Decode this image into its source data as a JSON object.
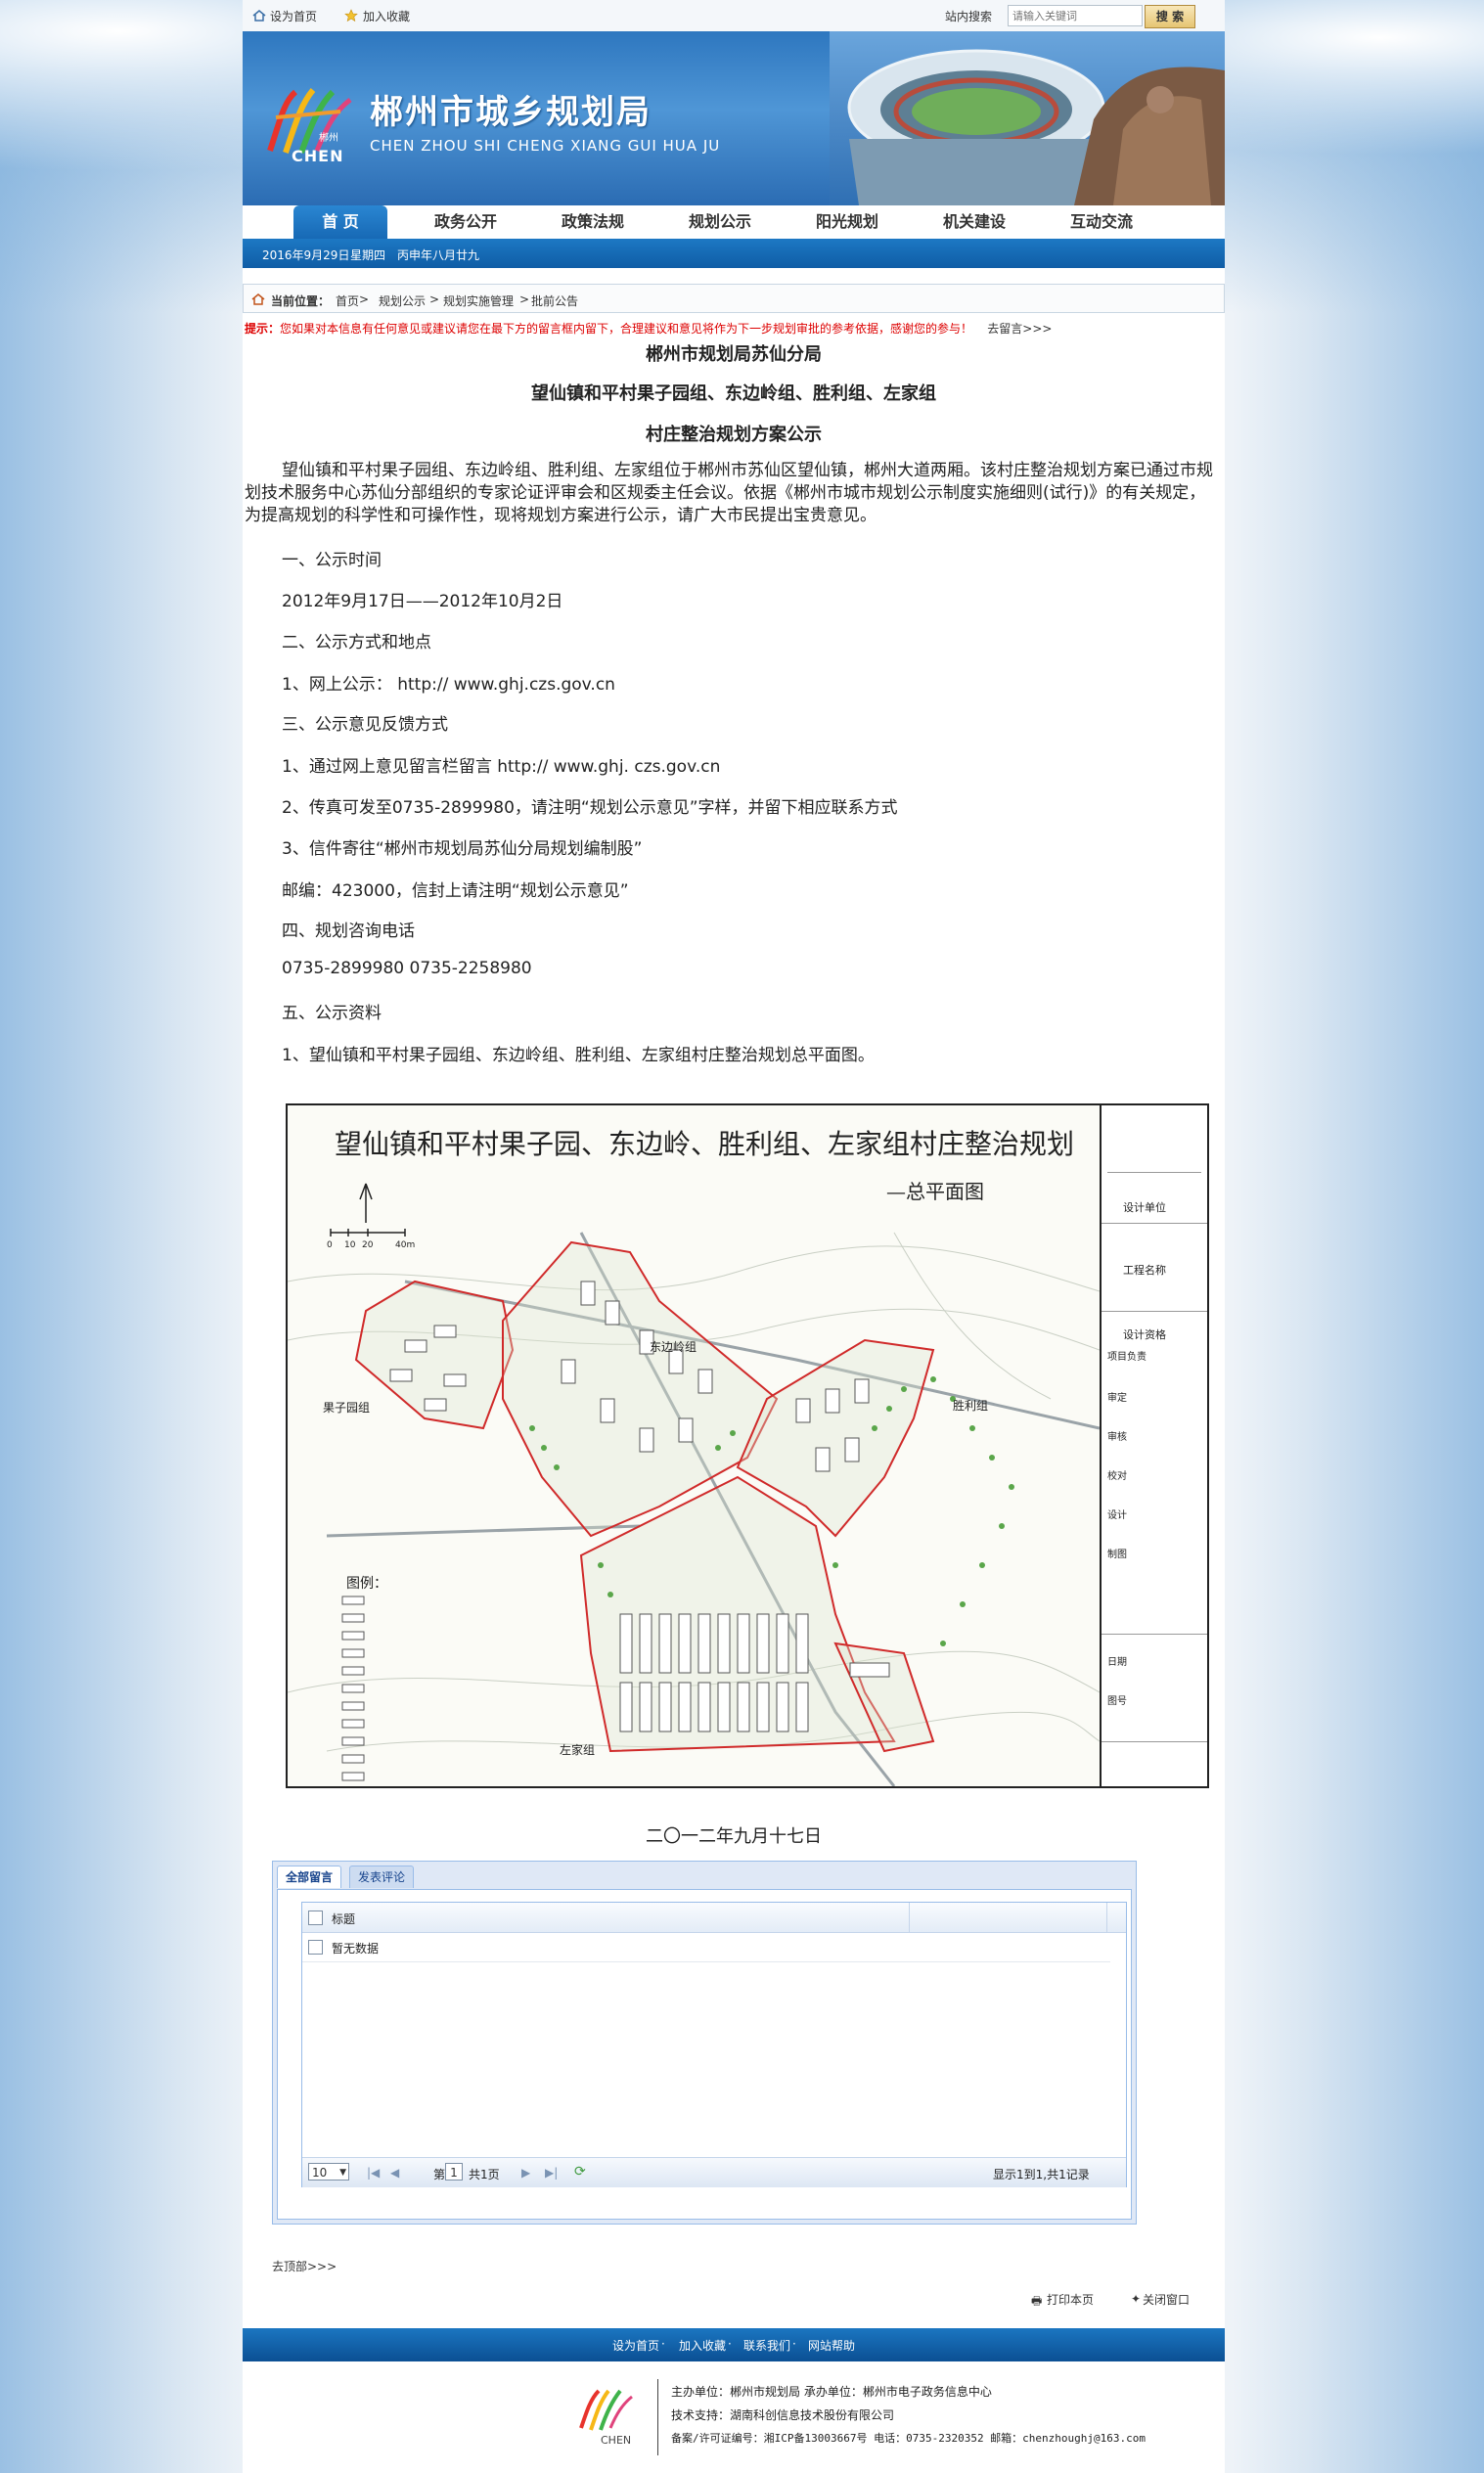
{
  "topbar": {
    "set_home": "设为首页",
    "add_favorite": "加入收藏",
    "site_search_label": "站内搜索",
    "search_placeholder": "请输入关键词",
    "search_button": "搜 索"
  },
  "banner": {
    "title": "郴州市城乡规划局",
    "subtitle": "CHEN ZHOU SHI CHENG XIANG GUI HUA JU",
    "logo_text": "CHEN",
    "logo_small": "郴州"
  },
  "nav": {
    "items": [
      "首 页",
      "政务公开",
      "政策法规",
      "规划公示",
      "阳光规划",
      "机关建设",
      "互动交流"
    ]
  },
  "datebar": {
    "date": "2016年9月29日",
    "weekday": "星期四",
    "lunar": "丙申年八月廿九"
  },
  "breadcrumb": {
    "label": "当前位置：",
    "items": [
      "首页",
      "规划公示",
      "规划实施管理",
      "批前公告"
    ],
    "sep": ">"
  },
  "tip": {
    "prefix": "提示：",
    "text": "您如果对本信息有任何意见或建议请您在最下方的留言框内留下，合理建议和意见将作为下一步规划审批的参考依据，感谢您的参与！",
    "link": "去留言>>>"
  },
  "article": {
    "org": "郴州市规划局苏仙分局",
    "title1": "望仙镇和平村果子园组、东边岭组、胜利组、左家组",
    "title2": "村庄整治规划方案公示",
    "intro": "望仙镇和平村果子园组、东边岭组、胜利组、左家组位于郴州市苏仙区望仙镇，郴州大道两厢。该村庄整治规划方案已通过市规划技术服务中心苏仙分部组织的专家论证评审会和区规委主任会议。依据《郴州市城市规划公示制度实施细则(试行)》的有关规定，为提高规划的科学性和可操作性，现将规划方案进行公示，请广大市民提出宝贵意见。",
    "lines": [
      "一、公示时间",
      "2012年9月17日——2012年10月2日",
      "二、公示方式和地点",
      "1、网上公示：  http:// www.ghj.czs.gov.cn",
      "三、公示意见反馈方式",
      "1、通过网上意见留言栏留言  http:// www.ghj. czs.gov.cn",
      "2、传真可发至0735-2899980，请注明“规划公示意见”字样，并留下相应联系方式",
      "3、信件寄往“郴州市规划局苏仙分局规划编制股”",
      "邮编：423000，信封上请注明“规划公示意见”",
      "四、规划咨询电话",
      "0735-2899980 0735-2258980",
      "五、公示资料",
      "1、望仙镇和平村果子园组、东边岭组、胜利组、左家组村庄整治规划总平面图。"
    ],
    "date_sign": "二〇一二年九月十七日"
  },
  "plan": {
    "title": "望仙镇和平村果子园、东边岭、胜利组、左家组村庄整治规划",
    "subtitle": "—总平面图",
    "legend_title": "图例：",
    "place_labels": [
      "果子园组",
      "东边岭组",
      "胜利组",
      "左家组"
    ],
    "scale_labels": [
      "0",
      "10",
      "20",
      "40m"
    ],
    "side_labels": [
      "设计单位",
      "工程名称",
      "设计资格",
      "项目负责",
      "审定",
      "审核",
      "校对",
      "设计",
      "制图",
      "日期",
      "图号"
    ]
  },
  "comments": {
    "tab_all": "全部留言",
    "tab_post": "发表评论",
    "col_title": "标题",
    "empty": "暂无数据",
    "page_size": "10",
    "page_prefix": "第",
    "page_num": "1",
    "page_suffix": "共1页",
    "summary": "显示1到1,共1记录"
  },
  "actions": {
    "go_top": "去顶部>>>",
    "print": "打印本页",
    "close": "关闭窗口"
  },
  "footer": {
    "links": [
      "设为首页",
      "加入收藏",
      "联系我们",
      "网站帮助"
    ],
    "sep": " · ",
    "host": "主办单位：郴州市规划局  承办单位：郴州市电子政务信息中心",
    "tech": "技术支持：湖南科创信息技术股份有限公司",
    "icp": "备案/许可证编号：湘ICP备13003667号  电话：0735-2320352  邮箱：chenzhoughj@163.com"
  },
  "colors": {
    "brand_blue": "#1769b5",
    "tip_red": "#dd0000",
    "plan_red": "#d02a2a"
  }
}
